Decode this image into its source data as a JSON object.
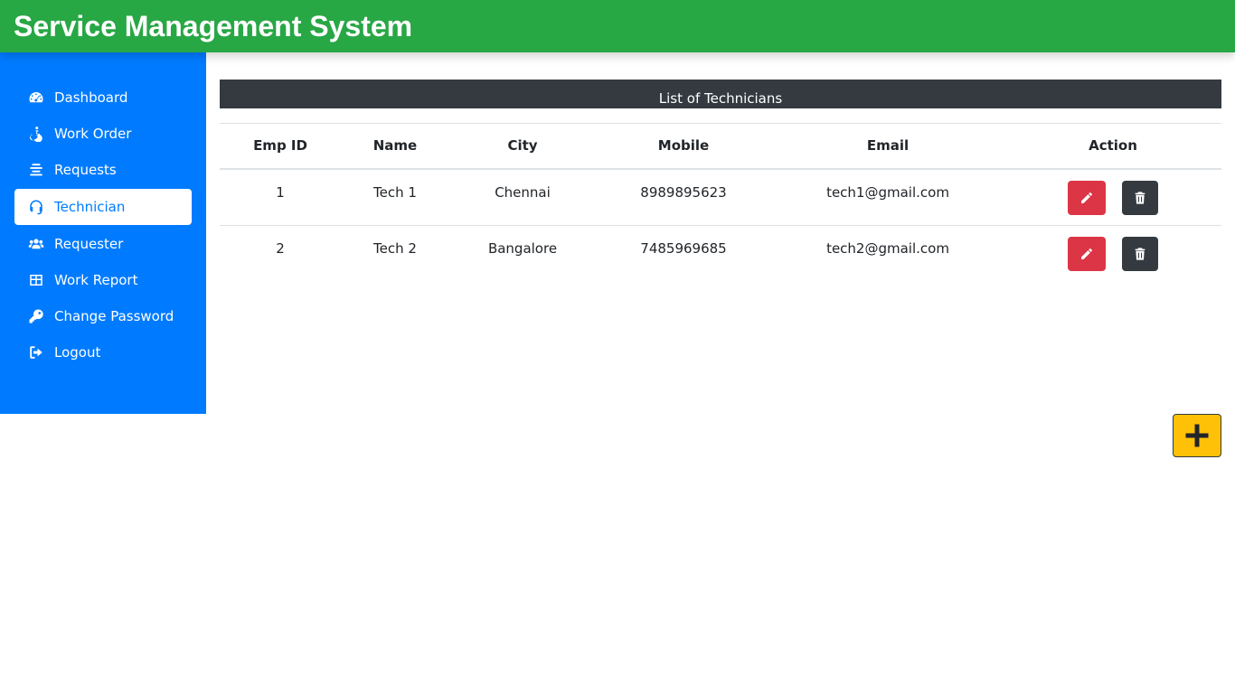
{
  "app": {
    "title": "Service Management System"
  },
  "sidebar": {
    "items": [
      {
        "label": "Dashboard",
        "icon": "tachometer-icon",
        "active": false
      },
      {
        "label": "Work Order",
        "icon": "accessible-icon",
        "active": false
      },
      {
        "label": "Requests",
        "icon": "align-center-icon",
        "active": false
      },
      {
        "label": "Technician",
        "icon": "headset-icon",
        "active": true
      },
      {
        "label": "Requester",
        "icon": "users-icon",
        "active": false
      },
      {
        "label": "Work Report",
        "icon": "table-icon",
        "active": false
      },
      {
        "label": "Change Password",
        "icon": "key-icon",
        "active": false
      },
      {
        "label": "Logout",
        "icon": "sign-out-icon",
        "active": false
      }
    ]
  },
  "technicians": {
    "caption": "List of Technicians",
    "columns": [
      "Emp ID",
      "Name",
      "City",
      "Mobile",
      "Email",
      "Action"
    ],
    "rows": [
      {
        "emp_id": "1",
        "name": "Tech 1",
        "city": "Chennai",
        "mobile": "8989895623",
        "email": "tech1@gmail.com"
      },
      {
        "emp_id": "2",
        "name": "Tech 2",
        "city": "Bangalore",
        "mobile": "7485969685",
        "email": "tech2@gmail.com"
      }
    ]
  },
  "colors": {
    "header_bg": "#28a745",
    "sidebar_bg": "#007bff",
    "caption_bg": "#343a40",
    "edit_button": "#dc3545",
    "delete_button": "#343a40",
    "add_button": "#ffc107"
  },
  "add_button": {
    "icon": "plus-icon"
  }
}
